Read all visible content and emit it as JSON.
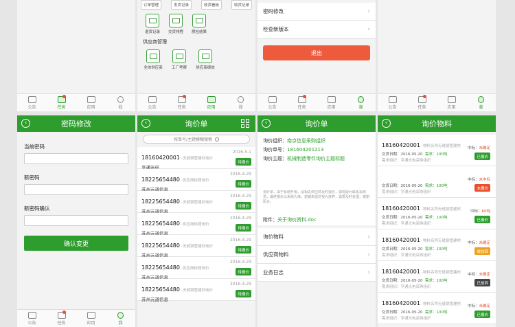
{
  "tabs": [
    "公告",
    "任务",
    "应用",
    "我"
  ],
  "p1": {
    "tabs_active": 1
  },
  "p2": {
    "row_buttons": [
      "订单管理",
      "发货记录",
      "收货看板",
      "收货记录"
    ],
    "tiles": [
      "退货记录",
      "交货排程",
      "质检结果"
    ],
    "section": "供应商管理",
    "tiles2": [
      "全体供应商",
      "工厂考察",
      "供应商绩效"
    ]
  },
  "p3": {
    "items": [
      "密码修改",
      "检查新版本"
    ],
    "logout": "退出"
  },
  "pwd": {
    "title": "密码修改",
    "fields": [
      "当前密码",
      "新密码",
      "新密码确认"
    ],
    "submit": "确认变更"
  },
  "inq": {
    "title": "询价单",
    "search_placeholder": "按单号/主题模糊搜索",
    "rows": [
      {
        "num": "18160420001",
        "desc": "-无缝钢管建材询价",
        "date": "2016-5-1",
        "org": "亨通光纤",
        "status": "待报价"
      },
      {
        "num": "18225654480",
        "desc": "-供应商标题询价",
        "date": "2016-4-29",
        "org": "苏州元道信息",
        "status": "待报价"
      },
      {
        "num": "18225654480",
        "desc": "-无缝钢管建材询价",
        "date": "2016-4-29",
        "org": "苏州元道信息",
        "status": "待报价"
      },
      {
        "num": "18225654480",
        "desc": "-供应商标题询价",
        "date": "2016-4-29",
        "org": "苏州元道信息",
        "status": "待报价"
      },
      {
        "num": "18225654480",
        "desc": "-无缝钢管建材询价",
        "date": "2016-4-29",
        "org": "苏州元道信息",
        "status": "待报价"
      },
      {
        "num": "18225654480",
        "desc": "-供应商标题询价",
        "date": "2016-4-29",
        "org": "苏州元道信息",
        "status": "待报价"
      },
      {
        "num": "18225654480",
        "desc": "-无缝钢管建材询价",
        "date": "2016-4-29",
        "org": "苏州元道信息",
        "status": "待报价"
      }
    ]
  },
  "detail": {
    "title": "询价单",
    "org_label": "询价组织：",
    "org_value": "南京信息采购组织",
    "num_label": "询价单号：",
    "num_value": "181604201213",
    "subject_label": "询价主题：",
    "subject_value": "机械制造零件询价主题标题",
    "note": "询价单，由于系统升级，请相关供应商及时报价，如有疑问联系采购员，最终报价以系统为准，逾期未提交视为放弃，需要及时处理，谢谢配合。",
    "attach_label": "附件：",
    "attach_value": "关于询价资料.doc",
    "items": [
      "询价物料",
      "供应商物料",
      "业务日志"
    ]
  },
  "mat": {
    "title": "询价物料",
    "rows": [
      {
        "num": "18160420001",
        "desc": "-物料名称无缝钢管建材",
        "date": "交货日期：2016-05-20",
        "qty": "需求：100吨",
        "bid": "中标：",
        "bid_v": "未确定",
        "org": "需求组织：亨通光电采购组织",
        "status": "已报价",
        "color": "#2d9d2d"
      },
      {
        "num": "",
        "desc": "",
        "date": "交货日期：2016-05-20",
        "qty": "需求：100吨",
        "bid": "中标：",
        "bid_v": "未中标",
        "org": "需求组织：亨通光电采购组织",
        "status": "未报价",
        "color": "#e8502e"
      },
      {
        "num": "18160420001",
        "desc": "-物料名称无缝钢管建材",
        "date": "交货日期：2016-05-20",
        "qty": "需求：100吨",
        "bid": "中标：",
        "bid_v": "60吨",
        "org": "需求组织：亨通光电采购组织",
        "status": "已报价",
        "color": "#2d9d2d"
      },
      {
        "num": "18160420001",
        "desc": "-物料名称无缝钢管建材",
        "date": "交货日期：2016-05-20",
        "qty": "需求：100吨",
        "bid": "中标：",
        "bid_v": "未确定",
        "org": "需求组织：亨通光电采购组织",
        "status": "被驳回",
        "color": "#f0a020"
      },
      {
        "num": "18160420001",
        "desc": "-物料名称无缝钢管建材",
        "date": "交货日期：2016-05-20",
        "qty": "需求：100吨",
        "bid": "中标：",
        "bid_v": "未确定",
        "org": "需求组织：亨通光电采购组织",
        "status": "已放弃",
        "color": "#444444"
      },
      {
        "num": "18160420001",
        "desc": "-物料名称无缝钢管建材",
        "date": "交货日期：2016-05-20",
        "qty": "需求：100吨",
        "bid": "中标：",
        "bid_v": "未确定",
        "org": "需求组织：亨通光电采购组织",
        "status": "已报价",
        "color": "#2d9d2d"
      }
    ]
  }
}
